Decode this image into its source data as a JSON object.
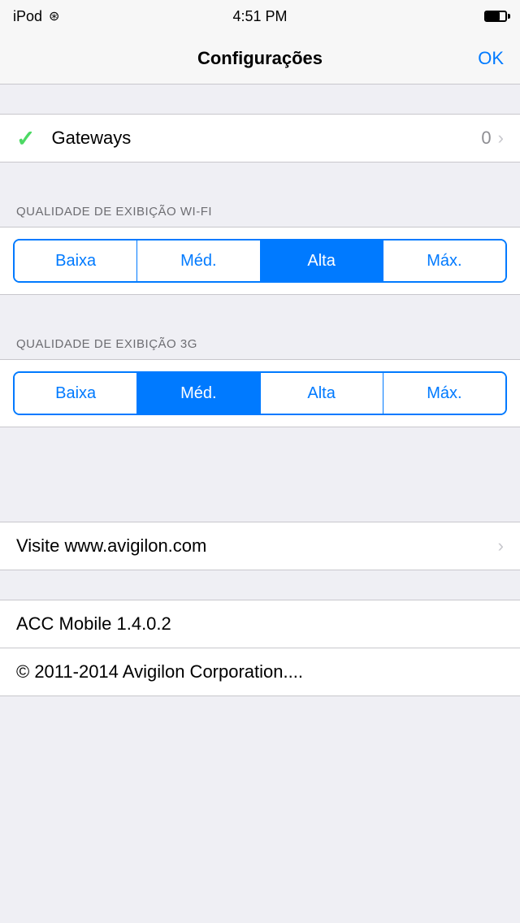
{
  "statusBar": {
    "device": "iPod",
    "time": "4:51 PM",
    "wifi": true
  },
  "navBar": {
    "title": "Configurações",
    "okLabel": "OK"
  },
  "gatewaysRow": {
    "label": "Gateways",
    "value": "0"
  },
  "wifiQuality": {
    "sectionHeader": "QUALIDADE DE EXIBIÇÃO WI-FI",
    "options": [
      "Baixa",
      "Méd.",
      "Alta",
      "Máx."
    ],
    "activeIndex": 2
  },
  "threeGQuality": {
    "sectionHeader": "QUALIDADE DE EXIBIÇÃO 3G",
    "options": [
      "Baixa",
      "Méd.",
      "Alta",
      "Máx."
    ],
    "activeIndex": 1
  },
  "visitRow": {
    "label": "Visite www.avigilon.com"
  },
  "versionRow": {
    "label": "ACC Mobile 1.4.0.2"
  },
  "copyrightRow": {
    "label": "© 2011-2014 Avigilon Corporation...."
  },
  "colors": {
    "accent": "#007aff",
    "checkmark": "#4cd964",
    "active_segment": "#007aff",
    "chevron": "#c7c7cc",
    "subtitle": "#8e8e93"
  }
}
